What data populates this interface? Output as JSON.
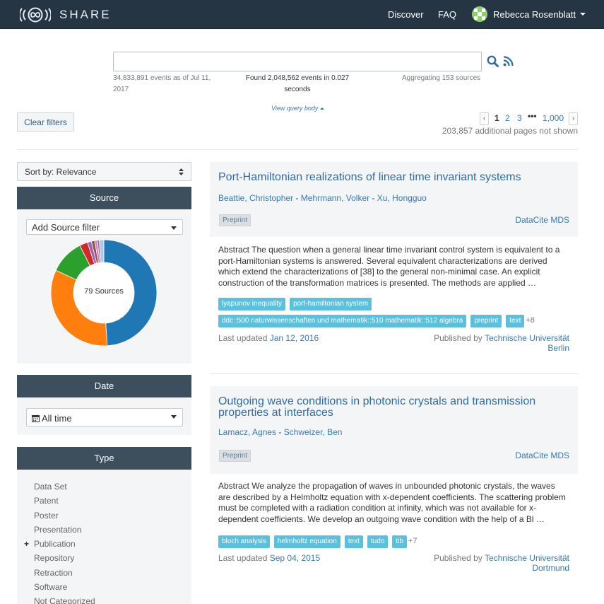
{
  "nav": {
    "brand": "SHARE",
    "discover": "Discover",
    "faq": "FAQ",
    "user": "Rebecca Rosenblatt"
  },
  "search": {
    "value": "",
    "events_line1": "34,833,891 events as of Jul 11,",
    "events_line2": "2017",
    "found_line1": "Found 2,048,562 events in 0.027",
    "found_line2": "seconds",
    "aggregating": "Aggregating 153 sources",
    "query_link": "View query body"
  },
  "filters": {
    "clear": "Clear filters",
    "sort": "Sort by: Relevance"
  },
  "pagination": {
    "prev": "‹",
    "next": "›",
    "pages": [
      "1",
      "2",
      "3"
    ],
    "ellipsis": "•••",
    "last": "1,000",
    "note": "203,857 additional pages not shown"
  },
  "source_panel": {
    "title": "Source",
    "dropdown": "Add Source filter",
    "donut_label": "79 Sources",
    "slices": [
      {
        "value": 0.49,
        "color": "#1f77b4"
      },
      {
        "value": 0.33,
        "color": "#ff7f0e"
      },
      {
        "value": 0.105,
        "color": "#2ca02c"
      },
      {
        "value": 0.025,
        "color": "#d62728"
      },
      {
        "value": 0.012,
        "color": "#9467bd"
      },
      {
        "value": 0.01,
        "color": "#8c564b"
      },
      {
        "value": 0.008,
        "color": "#e377c2"
      },
      {
        "value": 0.006,
        "color": "#7f7f7f"
      },
      {
        "value": 0.014,
        "color": "#aec7e8"
      }
    ]
  },
  "date_panel": {
    "title": "Date",
    "dropdown": "All time"
  },
  "type_panel": {
    "title": "Type",
    "items": [
      "Data Set",
      "Patent",
      "Poster",
      "Presentation",
      "Publication",
      "Repository",
      "Retraction",
      "Software",
      "Not Categorized"
    ]
  },
  "results": [
    {
      "title": "Port-Hamiltonian realizations of linear time invariant systems",
      "authors": [
        "Beattie, Christopher",
        "Mehrmann, Volker",
        "Xu, Hongguo"
      ],
      "type": "Preprint",
      "source": "DataCite MDS",
      "abstract": "Abstract The question when a general linear time invariant control system is equivalent to a port-Hamiltonian systems is answered. Several equivalent characterizations are derived which extend the characterizations of [38] to the general non-minimal case. An explicit construction of the transformation matrices is presented. The methods are applied …",
      "tags_row1": [
        "lyapunov inequality",
        "port-hamiltonian system"
      ],
      "tags_row2": [
        "ddc::500 naturwissenschaften und mathematik::510 mathematik::512 algebra",
        "preprint",
        "text"
      ],
      "more": "+8",
      "updated_label": "Last updated",
      "updated": "Jan 12, 2016",
      "published_label": "Published by",
      "publisher_line1": "Technische Universität",
      "publisher_line2": "Berlin"
    },
    {
      "title_line1": "Outgoing wave conditions in photonic crystals and transmission",
      "title_line2": "properties at interfaces",
      "authors": [
        "Lamacz, Agnes",
        "Schweizer, Ben"
      ],
      "type": "Preprint",
      "source": "DataCite MDS",
      "abstract": "Abstract We analyze the propagation of waves in unbounded photonic crystals, the waves are described by a Helmholtz equation with x-dependent coefficients. The scattering problem must be completed with a radiation condition at infinity, which was not available for x-dependent coefficients. We develop an outgoing wave condition with the help of a Bl …",
      "tags": [
        "bloch analysis",
        "helmholtz equation",
        "text",
        "tudo",
        "tib"
      ],
      "more": "+7",
      "updated_label": "Last updated",
      "updated": "Sep 04, 2015",
      "published_label": "Published by",
      "publisher_line1": "Technische Universität",
      "publisher_line2": "Dortmund"
    }
  ]
}
